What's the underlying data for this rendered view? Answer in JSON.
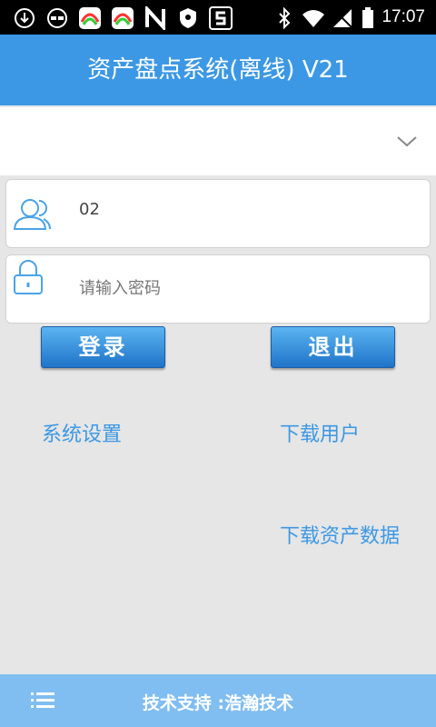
{
  "status": {
    "time": "17:07"
  },
  "header": {
    "title": "资产盘点系统(离线) V21"
  },
  "login": {
    "username_value": "02",
    "password_placeholder": "请输入密码",
    "login_label": "登录",
    "exit_label": "退出"
  },
  "links": {
    "settings": "系统设置",
    "download_users": "下载用户",
    "download_assets": "下载资产数据"
  },
  "footer": {
    "text": "技术支持 :浩瀚技术"
  },
  "colors": {
    "accent": "#3c98e4",
    "footer": "#80bdf0"
  },
  "icons": [
    "download-icon",
    "glasses-icon",
    "app-icon",
    "app-icon",
    "n-icon",
    "shield-icon",
    "s-icon",
    "bluetooth-icon",
    "wifi-icon",
    "no-sim-icon",
    "battery-icon",
    "chevron-down-icon",
    "user-icon",
    "lock-icon",
    "menu-icon"
  ]
}
